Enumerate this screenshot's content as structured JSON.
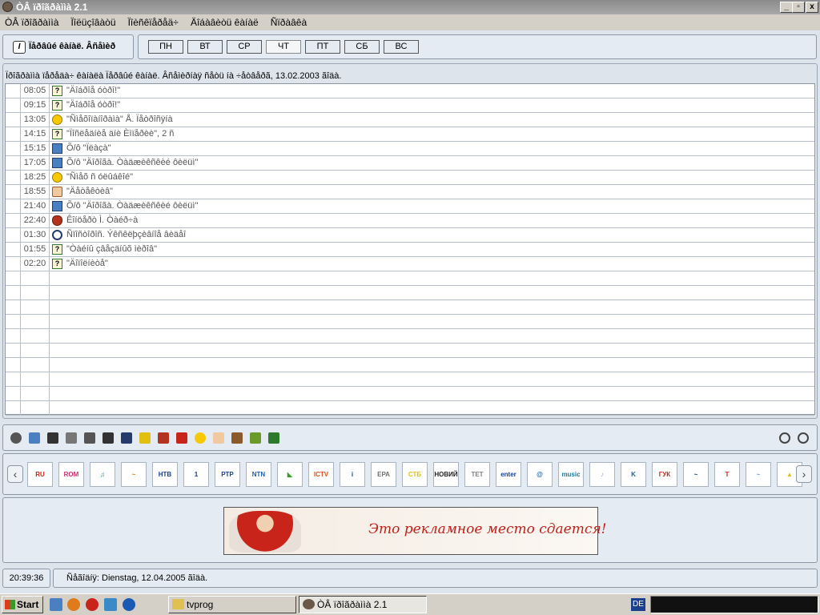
{
  "window": {
    "title": "ÒÂ ïðîãðàììà 2.1",
    "controls": {
      "minimize": "_",
      "maximize": "▫",
      "close": "x"
    }
  },
  "menu": [
    "ÒÂ ïðîãðàììà",
    "Ïîëüçîâàòü",
    "Ïîèñêïåðåä÷",
    "Äîáàâèòü êàíàë",
    "Ñïðàâêà"
  ],
  "channel": {
    "name": "Ïåðâûé êàíàë. Âñåìèð",
    "logo_letter": "I"
  },
  "days": [
    {
      "label": "ПН",
      "active": false
    },
    {
      "label": "ВТ",
      "active": false
    },
    {
      "label": "СР",
      "active": false
    },
    {
      "label": "ЧТ",
      "active": true
    },
    {
      "label": "ПТ",
      "active": false
    },
    {
      "label": "СБ",
      "active": false
    },
    {
      "label": "ВС",
      "active": false
    }
  ],
  "date_header": "Ïðîãðàììà ïåðåäà÷ êàíàëà Ïåðâûé êàíàë. Âñåìèðíàÿ ñåòü íà ÷åòâåðã, 13.02.2003 ãîäà.",
  "schedule": [
    {
      "time": "08:05",
      "icon": "doc",
      "title": "\"Äîáðîå óòðî!\""
    },
    {
      "time": "09:15",
      "icon": "doc",
      "title": "\"Äîáðîå óòðî!\""
    },
    {
      "time": "13:05",
      "icon": "smile",
      "title": "\"Ñìåõîïàíîðàìà\" Å. Ïåòðîñÿíà"
    },
    {
      "time": "14:15",
      "icon": "doc",
      "title": "\"Ïîñëåäíèå äíè Èìïåðèè\", 2 ñ"
    },
    {
      "time": "15:15",
      "icon": "book",
      "title": "Õ/ô \"Ïëàçà\""
    },
    {
      "time": "17:05",
      "icon": "book",
      "title": "Õ/ô \"Äîðîãà. Òàäæèêñêèé ôèëüì\""
    },
    {
      "time": "18:25",
      "icon": "smile",
      "title": "\"Ñìåõ ñ óëûáêîé\""
    },
    {
      "time": "18:55",
      "icon": "face",
      "title": "\"Äåòåêòèâ\""
    },
    {
      "time": "21:40",
      "icon": "book",
      "title": "Õ/ô \"Äîðîãà. Òàäæèêñêèé ôèëüì\""
    },
    {
      "time": "22:40",
      "icon": "guitar",
      "title": "Êîíöåðò Ì. Òàéð÷à"
    },
    {
      "time": "01:30",
      "icon": "mag",
      "title": "Ñïîñòîðîñ. Ýêñêëþçèâíîå âèäåî"
    },
    {
      "time": "01:55",
      "icon": "doc",
      "title": "\"Òàéíû çâåçäíûõ ìèðîâ\""
    },
    {
      "time": "02:20",
      "icon": "doc",
      "title": "\"Äîïîëíèòå\""
    }
  ],
  "empty_rows": 10,
  "toolbar_icons": [
    "globe-icon",
    "book-icon",
    "heart-icon",
    "camera-icon",
    "rocket-icon",
    "person-icon",
    "magnifier-icon",
    "bulb-icon",
    "guitar-icon",
    "dice-icon",
    "smile-icon",
    "face-icon",
    "dancer-icon",
    "tv-icon",
    "question-doc-icon"
  ],
  "toolbar_right_icons": [
    "alarm-clock-icon",
    "stopwatch-icon"
  ],
  "channels": [
    {
      "label": "RU",
      "color": "#c8241a"
    },
    {
      "label": "ROM",
      "color": "#c83070"
    },
    {
      "label": "♫",
      "color": "#1a8ab4"
    },
    {
      "label": "~",
      "color": "#e08010"
    },
    {
      "label": "НТВ",
      "color": "#1a3f8f"
    },
    {
      "label": "1",
      "color": "#1a3f8f"
    },
    {
      "label": "РТР",
      "color": "#1a3f8f"
    },
    {
      "label": "NTN",
      "color": "#1a5ab4"
    },
    {
      "label": "◣",
      "color": "#3a9a2a"
    },
    {
      "label": "ICTV",
      "color": "#e0501a"
    },
    {
      "label": "i",
      "color": "#1a3f8f"
    },
    {
      "label": "ЕРА",
      "color": "#707070"
    },
    {
      "label": "СТБ",
      "color": "#e0c010"
    },
    {
      "label": "НОВИЙ",
      "color": "#202020"
    },
    {
      "label": "ТЕТ",
      "color": "#808080"
    },
    {
      "label": "enter",
      "color": "#1a3f8f"
    },
    {
      "label": "@",
      "color": "#1a6ab4"
    },
    {
      "label": "music",
      "color": "#1a7a9a"
    },
    {
      "label": "♪",
      "color": "#9aaad0"
    },
    {
      "label": "K",
      "color": "#1a5ab4"
    },
    {
      "label": "ГУК",
      "color": "#c8241a"
    },
    {
      "label": "~",
      "color": "#1a4a7a"
    },
    {
      "label": "T",
      "color": "#c8241a"
    },
    {
      "label": "~",
      "color": "#7a9ac8"
    },
    {
      "label": "▲",
      "color": "#e0c010"
    }
  ],
  "ad": {
    "text": "Это рекламное место сдается!"
  },
  "status": {
    "clock": "20:39:36",
    "today": "Ñåãîäíÿ: Dienstag, 12.04.2005 ãîäà."
  },
  "taskbar": {
    "start": "Start",
    "tasks": [
      {
        "label": "tvprog",
        "active": false
      },
      {
        "label": "ÒÂ ïðîãðàììà 2.1",
        "active": true
      }
    ],
    "lang": "DE"
  }
}
